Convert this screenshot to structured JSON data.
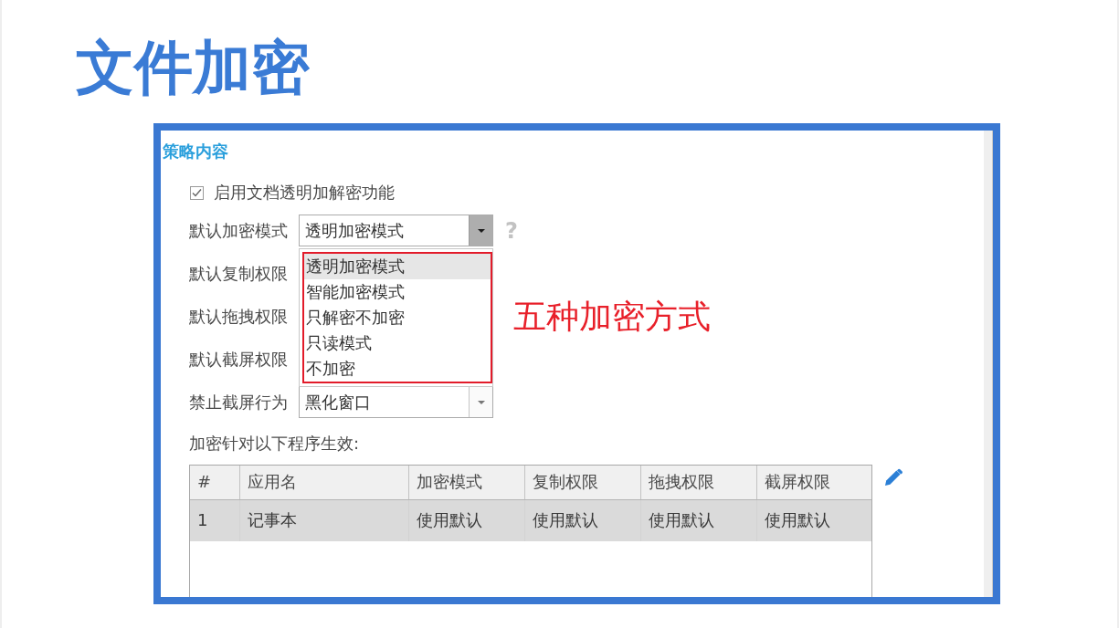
{
  "title": "文件加密",
  "screenshot": {
    "section_title": "策略内容",
    "enable_option": {
      "label": "启用文档透明加解密功能",
      "checked": true
    },
    "fields": [
      {
        "label": "默认加密模式",
        "value": "透明加密模式",
        "expanded": true,
        "help": "?",
        "options": [
          {
            "label": "透明加密模式",
            "selected": true
          },
          {
            "label": "智能加密模式",
            "selected": false
          },
          {
            "label": "只解密不加密",
            "selected": false
          },
          {
            "label": "只读模式",
            "selected": false
          },
          {
            "label": "不加密",
            "selected": false
          }
        ]
      },
      {
        "label": "默认复制权限"
      },
      {
        "label": "默认拖拽权限"
      },
      {
        "label": "默认截屏权限"
      },
      {
        "label": "禁止截屏行为",
        "value": "黑化窗口",
        "expanded": false
      }
    ],
    "annotation": "五种加密方式",
    "table_caption": "加密针对以下程序生效:",
    "table": {
      "columns": [
        "#",
        "应用名",
        "加密模式",
        "复制权限",
        "拖拽权限",
        "截屏权限"
      ],
      "rows": [
        {
          "cells": [
            "1",
            "记事本",
            "使用默认",
            "使用默认",
            "使用默认",
            "使用默认"
          ],
          "selected": true
        }
      ]
    }
  }
}
